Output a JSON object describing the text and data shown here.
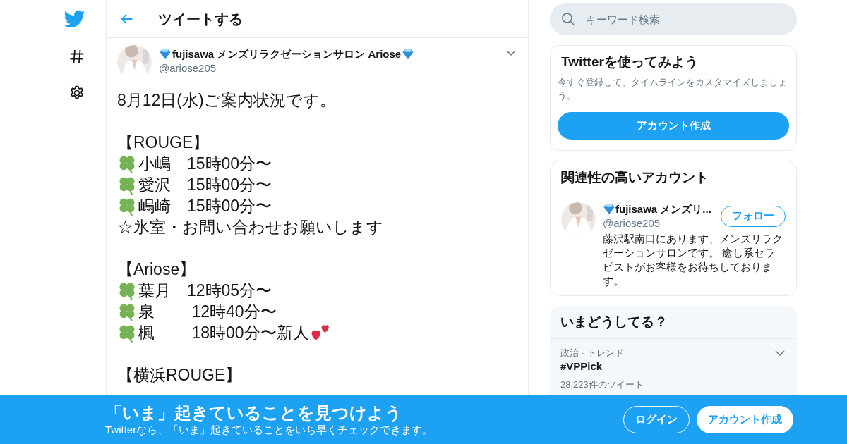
{
  "header": {
    "title": "ツイートする"
  },
  "tweet": {
    "author": {
      "name": "fujisawa メンズリラクゼーションサロン Ariose",
      "diamond_before": true,
      "diamond_after": true,
      "handle": "@ariose205"
    },
    "lines": [
      {
        "kind": "text",
        "text": "8月12日(水)ご案内状況です。"
      },
      {
        "kind": "blank"
      },
      {
        "kind": "text",
        "text": "【ROUGE】"
      },
      {
        "kind": "clover",
        "text": "小嶋　15時00分〜"
      },
      {
        "kind": "clover",
        "text": "愛沢　15時00分〜"
      },
      {
        "kind": "clover",
        "text": "嶋崎　15時00分〜"
      },
      {
        "kind": "text",
        "text": "☆氷室・お問い合わせお願いします"
      },
      {
        "kind": "blank"
      },
      {
        "kind": "text",
        "text": "【Ariose】"
      },
      {
        "kind": "clover",
        "text": "葉月　12時05分〜"
      },
      {
        "kind": "clover",
        "text": "泉　　 12時40分〜"
      },
      {
        "kind": "clover",
        "text": "楓　　 18時00分〜新人",
        "hearts": true
      },
      {
        "kind": "blank"
      },
      {
        "kind": "text",
        "text": "【横浜ROUGE】"
      }
    ]
  },
  "search": {
    "placeholder": "キーワード検索"
  },
  "signup_card": {
    "title": "Twitterを使ってみよう",
    "description": "今すぐ登録して、タイムラインをカスタマイズしましょう。",
    "button": "アカウント作成"
  },
  "related": {
    "title": "関連性の高いアカウント",
    "accounts": [
      {
        "name": "fujisawa メンズリ...",
        "diamond_before": true,
        "diamond_after": false,
        "handle": "@ariose205",
        "bio": "藤沢駅南口にあります、メンズリラクゼーションサロンです。 癒し系セラピストがお客様をお待ちしております。",
        "button": "フォロー"
      }
    ]
  },
  "trends": {
    "title": "いまどうしてる？",
    "items": [
      {
        "context": "政治 · トレンド",
        "name": "#VPPick",
        "count": "28,223件のツイート"
      }
    ]
  },
  "banner": {
    "title": "「いま」起きていることを見つけよう",
    "subtitle": "Twitterなら、「いま」起きていることをいち早くチェックできます。",
    "buttons": [
      {
        "kind": "outline",
        "label": "ログイン"
      },
      {
        "kind": "filled",
        "label": "アカウント作成"
      }
    ]
  }
}
